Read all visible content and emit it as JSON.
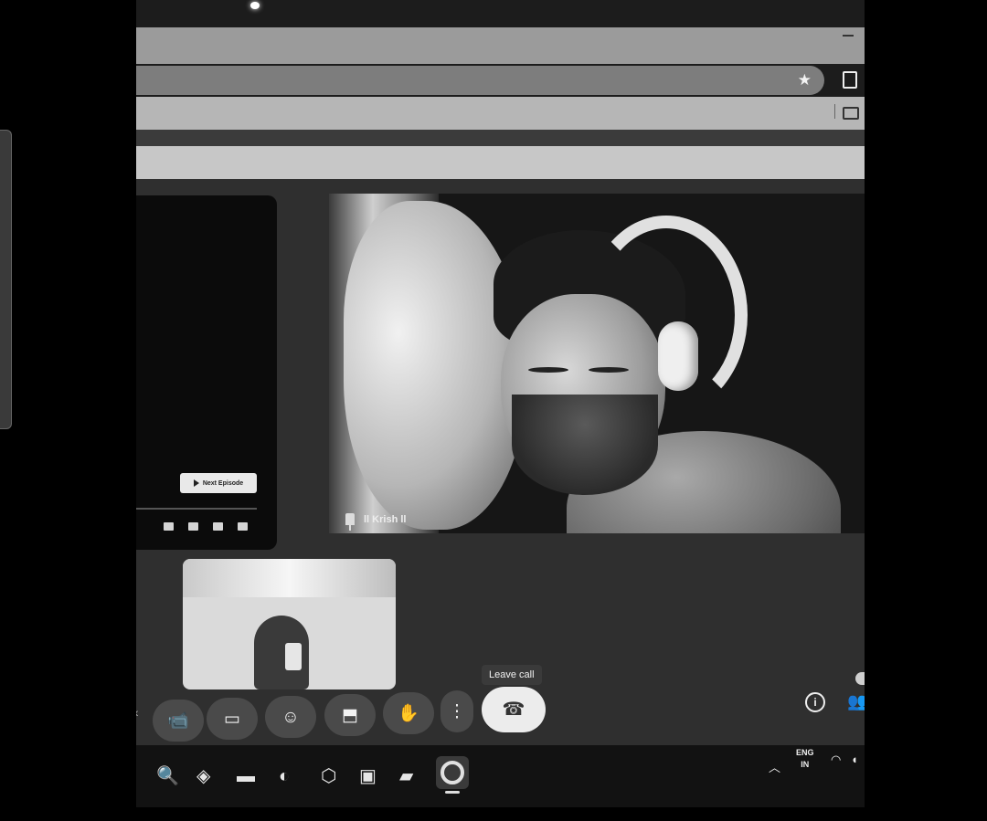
{
  "meeting": {
    "participant_name": "ll Krish ll",
    "leave_tooltip": "Leave call"
  },
  "player": {
    "next_episode_label": "Next Episode"
  },
  "controls": [
    {
      "name": "more-controls-chevron",
      "icon": "‹"
    },
    {
      "name": "camera",
      "icon": "📹"
    },
    {
      "name": "captions",
      "icon": "▭"
    },
    {
      "name": "emoji-reactions",
      "icon": "☺"
    },
    {
      "name": "present-screen",
      "icon": "⬒"
    },
    {
      "name": "raise-hand",
      "icon": "✋"
    },
    {
      "name": "more-options",
      "icon": "⋮"
    },
    {
      "name": "leave-call",
      "icon": "☎"
    }
  ],
  "taskbar": {
    "apps": [
      "search-icon",
      "copilot-icon",
      "file-explorer-icon",
      "edge-browser-icon",
      "office-icon",
      "store-icon",
      "notes-app-icon",
      "chrome-icon"
    ],
    "language_top": "ENG",
    "language_bottom": "IN"
  },
  "colors": {
    "screen_bg": "#1c1c1c",
    "meet_bg": "#2f2f2f",
    "button_bg": "#4a4a4a",
    "leave_button": "#ececec"
  }
}
